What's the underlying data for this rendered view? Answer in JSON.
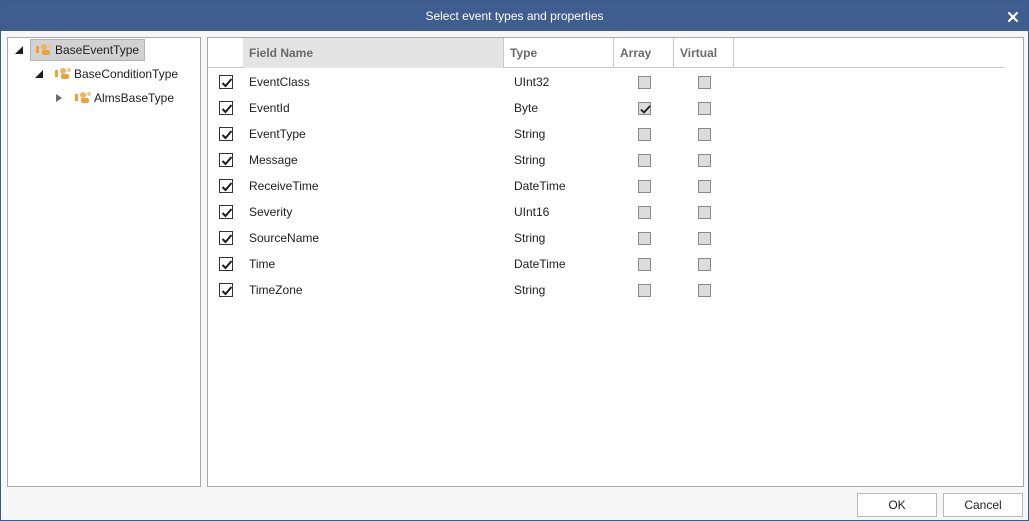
{
  "window": {
    "title": "Select event types and properties",
    "accent_color": "#3f5d8f"
  },
  "tree": {
    "items": [
      {
        "label": "BaseEventType",
        "expanded": true,
        "selected": true,
        "icon": "event-type-icon"
      },
      {
        "label": "BaseConditionType",
        "expanded": true,
        "selected": false,
        "icon": "event-type-icon"
      },
      {
        "label": "AlmsBaseType",
        "expanded": false,
        "selected": false,
        "icon": "event-type-icon"
      }
    ]
  },
  "grid": {
    "columns": {
      "field_name": "Field Name",
      "type": "Type",
      "array": "Array",
      "virtual": "Virtual"
    },
    "rows": [
      {
        "selected": true,
        "name": "EventClass",
        "type": "UInt32",
        "array": false,
        "virtual": false
      },
      {
        "selected": true,
        "name": "EventId",
        "type": "Byte",
        "array": true,
        "virtual": false
      },
      {
        "selected": true,
        "name": "EventType",
        "type": "String",
        "array": false,
        "virtual": false
      },
      {
        "selected": true,
        "name": "Message",
        "type": "String",
        "array": false,
        "virtual": false
      },
      {
        "selected": true,
        "name": "ReceiveTime",
        "type": "DateTime",
        "array": false,
        "virtual": false
      },
      {
        "selected": true,
        "name": "Severity",
        "type": "UInt16",
        "array": false,
        "virtual": false
      },
      {
        "selected": true,
        "name": "SourceName",
        "type": "String",
        "array": false,
        "virtual": false
      },
      {
        "selected": true,
        "name": "Time",
        "type": "DateTime",
        "array": false,
        "virtual": false
      },
      {
        "selected": true,
        "name": "TimeZone",
        "type": "String",
        "array": false,
        "virtual": false
      }
    ]
  },
  "buttons": {
    "ok": "OK",
    "cancel": "Cancel"
  }
}
